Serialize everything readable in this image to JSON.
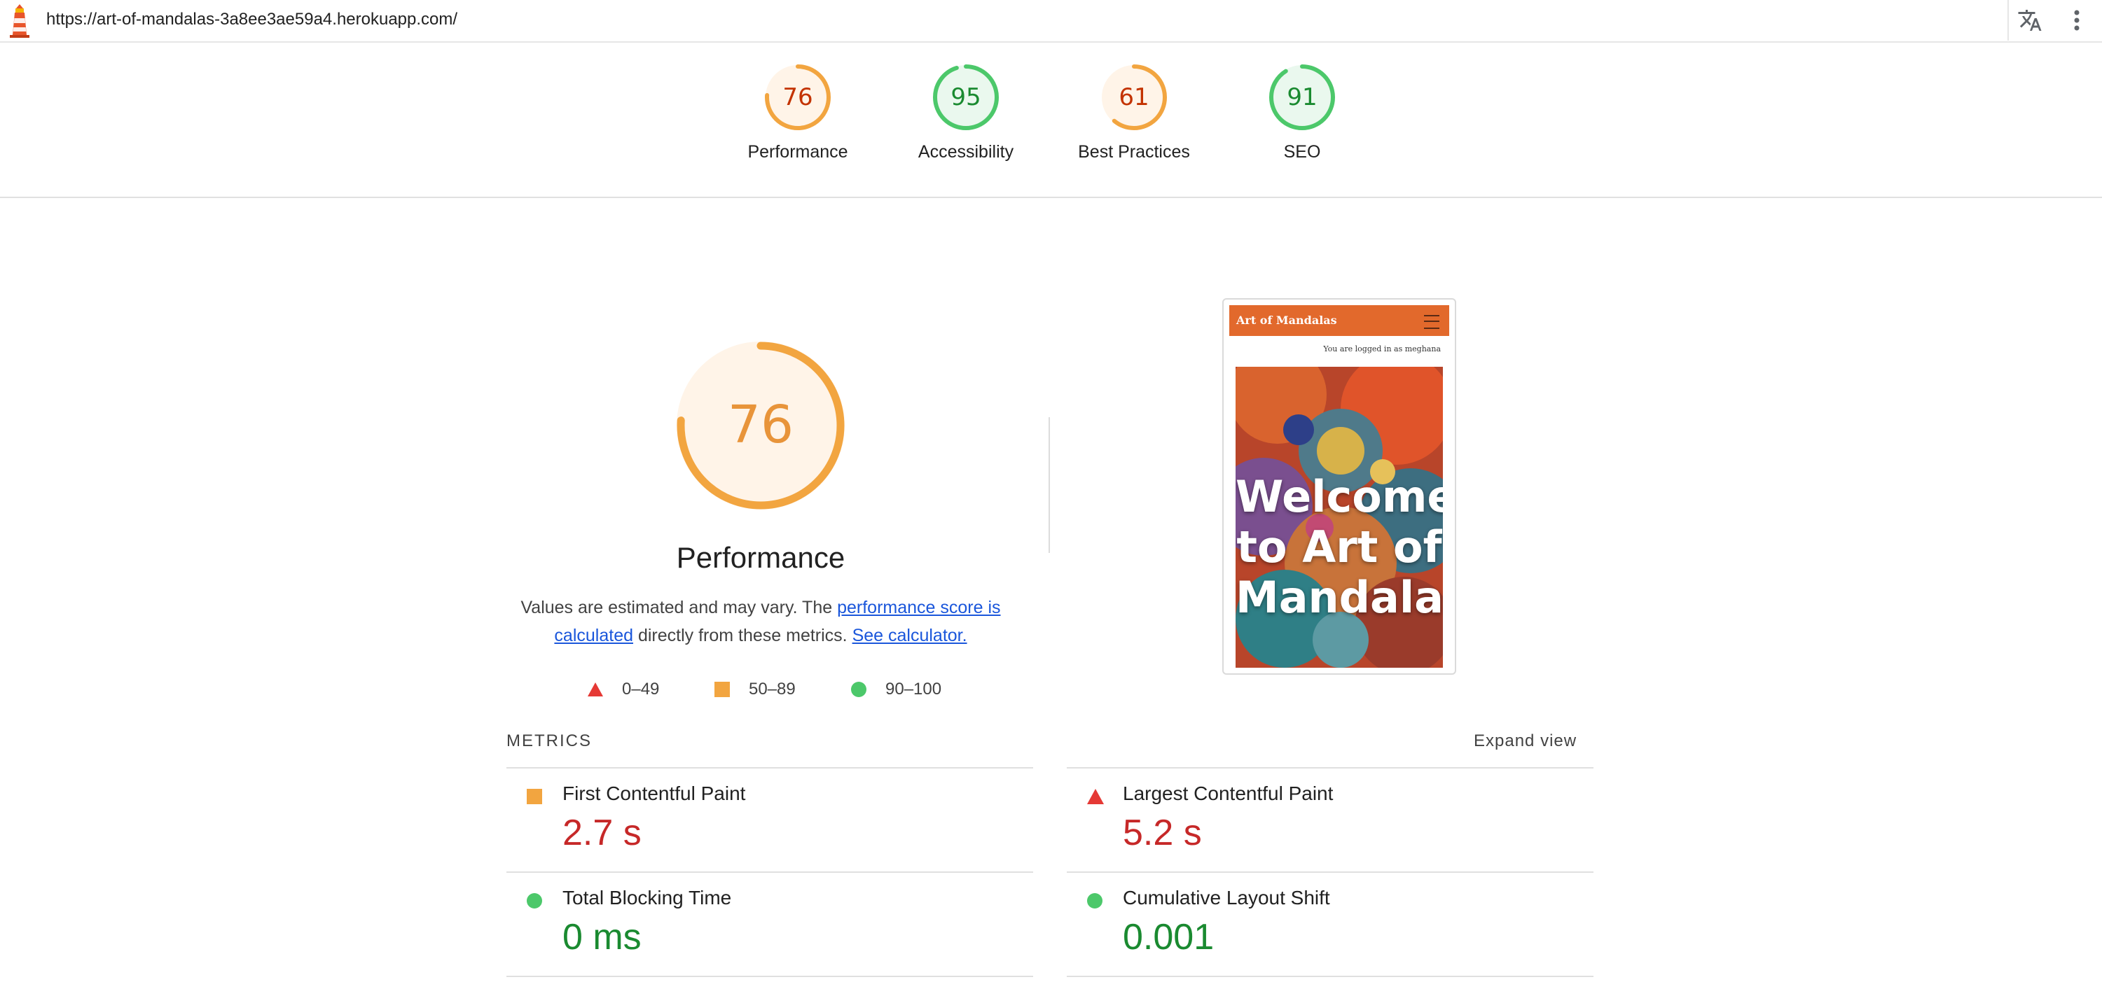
{
  "topbar": {
    "url": "https://art-of-mandalas-3a8ee3ae59a4.herokuapp.com/",
    "logo_icon": "lighthouse-icon",
    "translate_icon": "translate-icon",
    "menu_icon": "more-vert-icon"
  },
  "scores": [
    {
      "value": "76",
      "score": 76,
      "label": "Performance",
      "status": "average"
    },
    {
      "value": "95",
      "score": 95,
      "label": "Accessibility",
      "status": "pass"
    },
    {
      "value": "61",
      "score": 61,
      "label": "Best Practices",
      "status": "average"
    },
    {
      "value": "91",
      "score": 91,
      "label": "SEO",
      "status": "pass"
    }
  ],
  "colors": {
    "fail": "#e53935",
    "fail_text": "#c62828",
    "average_arc": "#f2a540",
    "average_text": "#c33300",
    "average_bg": "#fff4e8",
    "pass_arc": "#4cc86a",
    "pass_text": "#1a8a30",
    "pass_bg": "#eaf8ee",
    "link": "#1a56db"
  },
  "performance": {
    "score_text": "76",
    "score": 76,
    "title": "Performance",
    "desc_prefix": "Values are estimated and may vary. The ",
    "desc_link1": "performance score is calculated",
    "desc_middle": " directly from these metrics. ",
    "desc_link2": "See calculator."
  },
  "legend": [
    {
      "shape": "triangle",
      "range": "0–49"
    },
    {
      "shape": "square",
      "range": "50–89"
    },
    {
      "shape": "circle",
      "range": "90–100"
    }
  ],
  "screenshot": {
    "nav_title": "Art of Mandalas",
    "logged_in": "You are logged in as meghana",
    "hero_text": "Welcome to Art of Mandalas"
  },
  "metrics": {
    "heading": "METRICS",
    "expand_label": "Expand view",
    "items": [
      {
        "title": "First Contentful Paint",
        "value": "2.7 s",
        "status": "average"
      },
      {
        "title": "Largest Contentful Paint",
        "value": "5.2 s",
        "status": "fail"
      },
      {
        "title": "Total Blocking Time",
        "value": "0 ms",
        "status": "pass"
      },
      {
        "title": "Cumulative Layout Shift",
        "value": "0.001",
        "status": "pass"
      }
    ]
  }
}
